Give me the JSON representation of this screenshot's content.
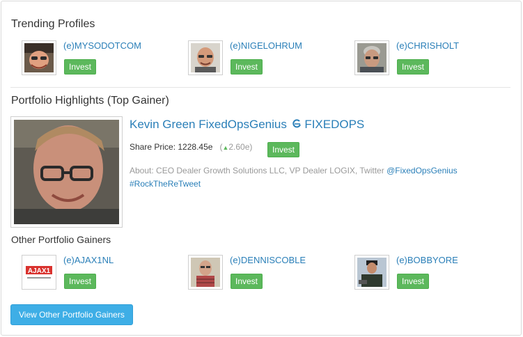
{
  "trending": {
    "title": "Trending Profiles",
    "profiles": [
      {
        "handle": "(e)MYSODOTCOM",
        "invest": "Invest"
      },
      {
        "handle": "(e)NIGELOHRUM",
        "invest": "Invest"
      },
      {
        "handle": "(e)CHRISHOLT",
        "invest": "Invest"
      }
    ]
  },
  "highlights": {
    "title": "Portfolio Highlights (Top Gainer)",
    "name": "Kevin Green FixedOpsGenius",
    "symbol": "FIXEDOPS",
    "share_label": "Share Price:",
    "share_price": "1228.45e",
    "change": "2.60e",
    "invest": "Invest",
    "about_prefix": "About: CEO Dealer Growth Solutions LLC, VP Dealer LOGIX, Twitter",
    "about_link1": "@FixedOpsGenius",
    "about_link2": "#RockTheReTweet"
  },
  "other": {
    "title": "Other Portfolio Gainers",
    "profiles": [
      {
        "handle": "(e)AJAX1NL",
        "invest": "Invest"
      },
      {
        "handle": "(e)DENNISCOBLE",
        "invest": "Invest"
      },
      {
        "handle": "(e)BOBBYORE",
        "invest": "Invest"
      }
    ],
    "logo_text": "AJAX1",
    "view_button": "View Other Portfolio Gainers"
  },
  "colors": {
    "link": "#2a7fb8",
    "invest": "#5cb85c",
    "primary_button": "#3eaee6",
    "muted": "#999999"
  }
}
